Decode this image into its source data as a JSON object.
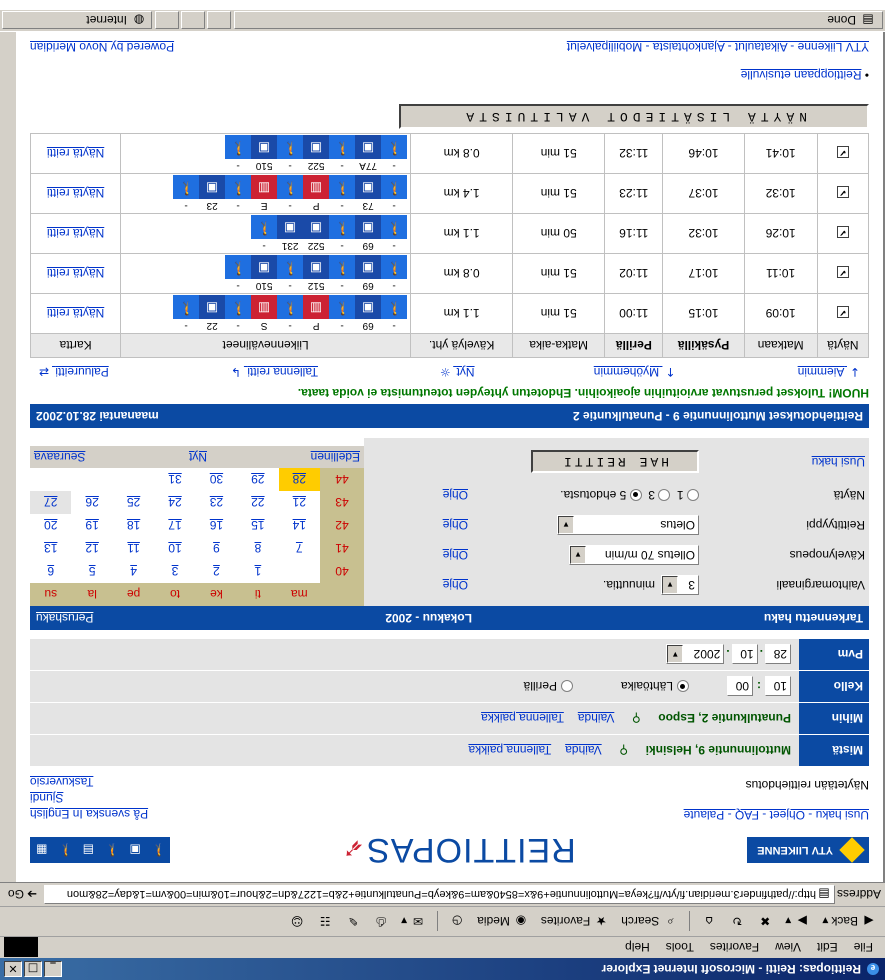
{
  "window": {
    "title": "Reittiopas: Reitti - Microsoft Internet Explorer",
    "menu": [
      "File",
      "Edit",
      "View",
      "Favorites",
      "Tools",
      "Help"
    ],
    "toolbar": {
      "back": "Back",
      "search": "Search",
      "favorites": "Favorites",
      "media": "Media"
    },
    "address_label": "Address",
    "address_url": "http://pathfinder3.meridian.fi/ytv/fi?keya=Muttolinnuntie+9&x=8540&am=9&keyb=Punatulkuntie+2&b=1227&dn=2&hour=10&min=00&vm=1&day=28&mon",
    "go_label": "Go",
    "status_text": "Done",
    "zone": "Internet"
  },
  "header": {
    "ytv_logo": "YTV LIIKENNE",
    "brand": "REITTIOPAS",
    "links": {
      "top_left": "Uusi haku - Ohjeet - FAQ - Palaute",
      "top_right_1": "Taskuversio",
      "top_right_2": "Sjundi",
      "top_right_3": "På svenska  In English",
      "subtitle": "Näytetään reittiehdotus"
    }
  },
  "form": {
    "mista_label": "Mistä",
    "mista_value": "Muttolinnuntie 9, Helsinki",
    "mista_change": "Vaihda",
    "mista_save": "Tallenna paikka",
    "mihin_label": "Mihin",
    "mihin_value": "Punatulkuntie 2, Espoo",
    "mihin_change": "Vaihda",
    "mihin_save": "Tallenna paikka",
    "kello_label": "Kello",
    "kello_h": "10",
    "kello_m": "00",
    "lahtoaika": "Lähtöaika",
    "perilla": "Perillä",
    "pvm_label": "Pvm",
    "pvm_d": "28",
    "pvm_m": "10",
    "pvm_y": "2002"
  },
  "refined": {
    "title": "Tarkennettu haku",
    "month": "Lokakuu - 2002",
    "basic": "Perushaku"
  },
  "options": {
    "vaihtomarginaali_label": "Vaihtomarginaali",
    "vaihtomarginaali_value": "3",
    "vaihtomarginaali_unit": "minuuttia.",
    "kavelynopeus_label": "Kävelynopeus",
    "kavelynopeus_value": "Olletus 70 m/min",
    "reittityyppi_label": "Reittityyppi",
    "reittityyppi_value": "Oletus",
    "nayta_label": "Näytä",
    "nayta_opts": [
      "1",
      "3",
      "5 ehdotusta."
    ],
    "help": "Ohje",
    "search_button": "HAE REITTI",
    "new_search": "Uusi haku"
  },
  "calendar": {
    "weekdays": [
      "ma",
      "ti",
      "ke",
      "to",
      "pe",
      "la",
      "su"
    ],
    "weeks": [
      {
        "num": "40",
        "days": [
          "",
          "1",
          "2",
          "3",
          "4",
          "5",
          "6"
        ]
      },
      {
        "num": "41",
        "days": [
          "7",
          "8",
          "9",
          "10",
          "11",
          "12",
          "13"
        ]
      },
      {
        "num": "42",
        "days": [
          "14",
          "15",
          "16",
          "17",
          "18",
          "19",
          "20"
        ]
      },
      {
        "num": "43",
        "days": [
          "21",
          "22",
          "23",
          "24",
          "25",
          "26",
          "27"
        ]
      },
      {
        "num": "44",
        "days": [
          "28",
          "29",
          "30",
          "31",
          "",
          "",
          ""
        ]
      }
    ],
    "prev": "Edellinen",
    "now": "Nyt",
    "next": "Seuraava"
  },
  "results_header": {
    "title": "Reittiehdotukset Muttolinnuntie 9 - Punatulkuntie 2",
    "date": "maanantai 28.10.2002"
  },
  "warning": "HUOM! Tulokset perustuvat arvioituihin ajoaikoihin. Ehdotetun yhteyden toteutumista ei voida taata.",
  "nav": {
    "earlier": "Aiemmin",
    "later": "Myöhemmin",
    "now": "Nyt",
    "save_route": "Tallenna reitti",
    "return_route": "Paluureitti"
  },
  "results": {
    "headers": [
      "Näytä",
      "Matkaan",
      "Pysäkillä",
      "Perillä",
      "Matka-aika",
      "Kävelyä yht.",
      "Liikennevälineet",
      "Kartta"
    ],
    "map_link": "Näytä reitti",
    "rows": [
      {
        "depart": "10:09",
        "stop": "10:15",
        "arrive": "11:00",
        "duration": "51 min",
        "walk": "1.1 km",
        "codes": [
          "-",
          "69",
          "-",
          "P",
          "-",
          "S",
          "-",
          "22",
          "-"
        ],
        "modes": [
          "walk",
          "bus",
          "walk",
          "train",
          "walk",
          "train",
          "walk",
          "bus",
          "walk"
        ]
      },
      {
        "depart": "10:11",
        "stop": "10:17",
        "arrive": "11:02",
        "duration": "51 min",
        "walk": "0.8 km",
        "codes": [
          "-",
          "69",
          "-",
          "512",
          "-",
          "510",
          "-"
        ],
        "modes": [
          "walk",
          "bus",
          "walk",
          "bus",
          "walk",
          "bus",
          "walk"
        ]
      },
      {
        "depart": "10:26",
        "stop": "10:32",
        "arrive": "11:16",
        "duration": "50 min",
        "walk": "1.1 km",
        "codes": [
          "-",
          "69",
          "-",
          "522",
          "231",
          "-"
        ],
        "modes": [
          "walk",
          "bus",
          "walk",
          "bus",
          "bus",
          "walk"
        ]
      },
      {
        "depart": "10:32",
        "stop": "10:37",
        "arrive": "11:23",
        "duration": "51 min",
        "walk": "1.4 km",
        "codes": [
          "-",
          "73",
          "-",
          "P",
          "-",
          "E",
          "-",
          "23",
          "-"
        ],
        "modes": [
          "walk",
          "bus",
          "walk",
          "train",
          "walk",
          "train",
          "walk",
          "bus",
          "walk"
        ]
      },
      {
        "depart": "10:41",
        "stop": "10:46",
        "arrive": "11:32",
        "duration": "51 min",
        "walk": "0.8 km",
        "codes": [
          "-",
          "77A",
          "-",
          "522",
          "-",
          "510",
          "-"
        ],
        "modes": [
          "walk",
          "bus",
          "walk",
          "bus",
          "walk",
          "bus",
          "walk"
        ]
      }
    ]
  },
  "more_button": "NÄYTÄ LISÄTIEDOT VALITUISTA",
  "footer": {
    "home": "Reittioppaan etusivulle",
    "links_left": "YTV Liikenne - Aikataulut - Ajankohtaista - Mobiilipalvelut",
    "powered": "Powered by Novo Meridian"
  }
}
